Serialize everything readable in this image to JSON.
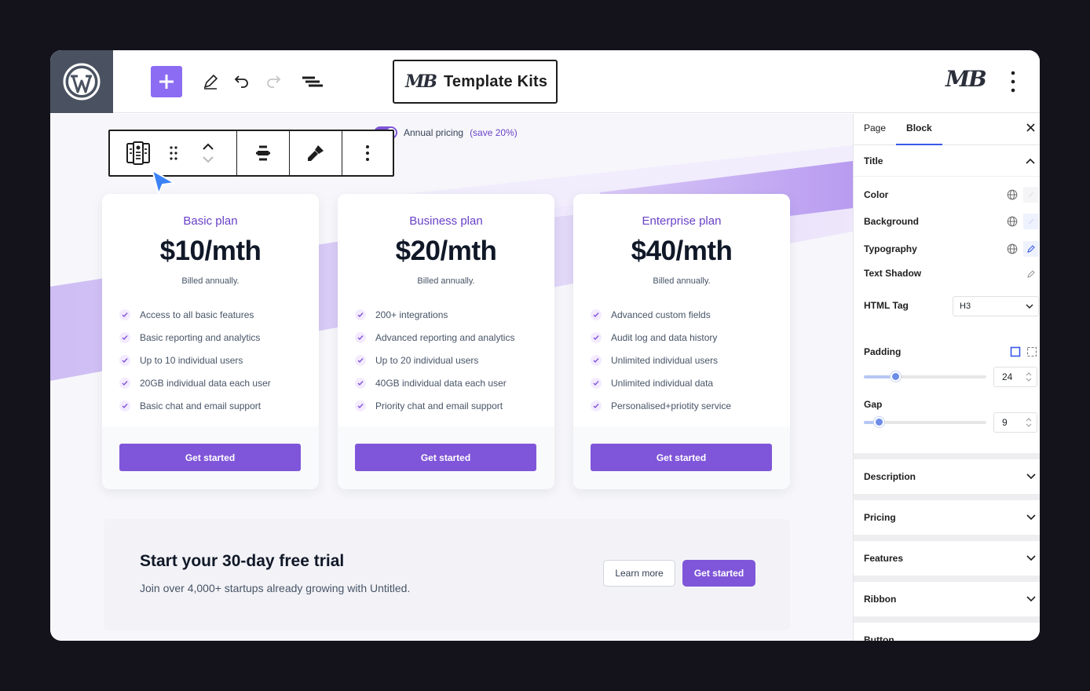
{
  "topbar": {
    "brand_label": "Template Kits",
    "brand_mark": "MB",
    "tools": [
      "add-icon",
      "pencil-icon",
      "undo-icon",
      "redo-icon",
      "list-view-icon"
    ]
  },
  "canvas": {
    "toggle_label": "Annual pricing",
    "toggle_save": "(save 20%)",
    "plans": [
      {
        "name": "Basic plan",
        "price": "$10/mth",
        "billed": "Billed annually.",
        "features": [
          "Access to all basic features",
          "Basic reporting and analytics",
          "Up to 10 individual users",
          "20GB individual data each user",
          "Basic chat and email support"
        ],
        "cta": "Get started"
      },
      {
        "name": "Business plan",
        "price": "$20/mth",
        "billed": "Billed annually.",
        "features": [
          "200+ integrations",
          "Advanced reporting and analytics",
          "Up to 20 individual users",
          "40GB individual data each user",
          "Priority chat and email support"
        ],
        "cta": "Get started"
      },
      {
        "name": "Enterprise plan",
        "price": "$40/mth",
        "billed": "Billed annually.",
        "features": [
          "Advanced custom fields",
          "Audit log and data history",
          "Unlimited individual users",
          "Unlimited individual data",
          "Personalised+priotity service"
        ],
        "cta": "Get started"
      }
    ],
    "trial": {
      "title": "Start your 30-day free trial",
      "subtitle": "Join over 4,000+ startups already growing with Untitled.",
      "learn_more": "Learn more",
      "cta": "Get started"
    }
  },
  "sidebar": {
    "tabs": [
      "Page",
      "Block"
    ],
    "active_tab": "Block",
    "section_title": "Title",
    "color_label": "Color",
    "background_label": "Background",
    "typography_label": "Typography",
    "text_shadow_label": "Text Shadow",
    "html_tag_label": "HTML Tag",
    "html_tag_value": "H3",
    "padding_label": "Padding",
    "padding_value": "24",
    "gap_label": "Gap",
    "gap_value": "9",
    "collapsed_sections": [
      "Description",
      "Pricing",
      "Features",
      "Ribbon",
      "Button"
    ]
  },
  "colors": {
    "accent": "#7f56d9",
    "wp_accent": "#3858e9",
    "add_button": "#8c6cf2"
  }
}
